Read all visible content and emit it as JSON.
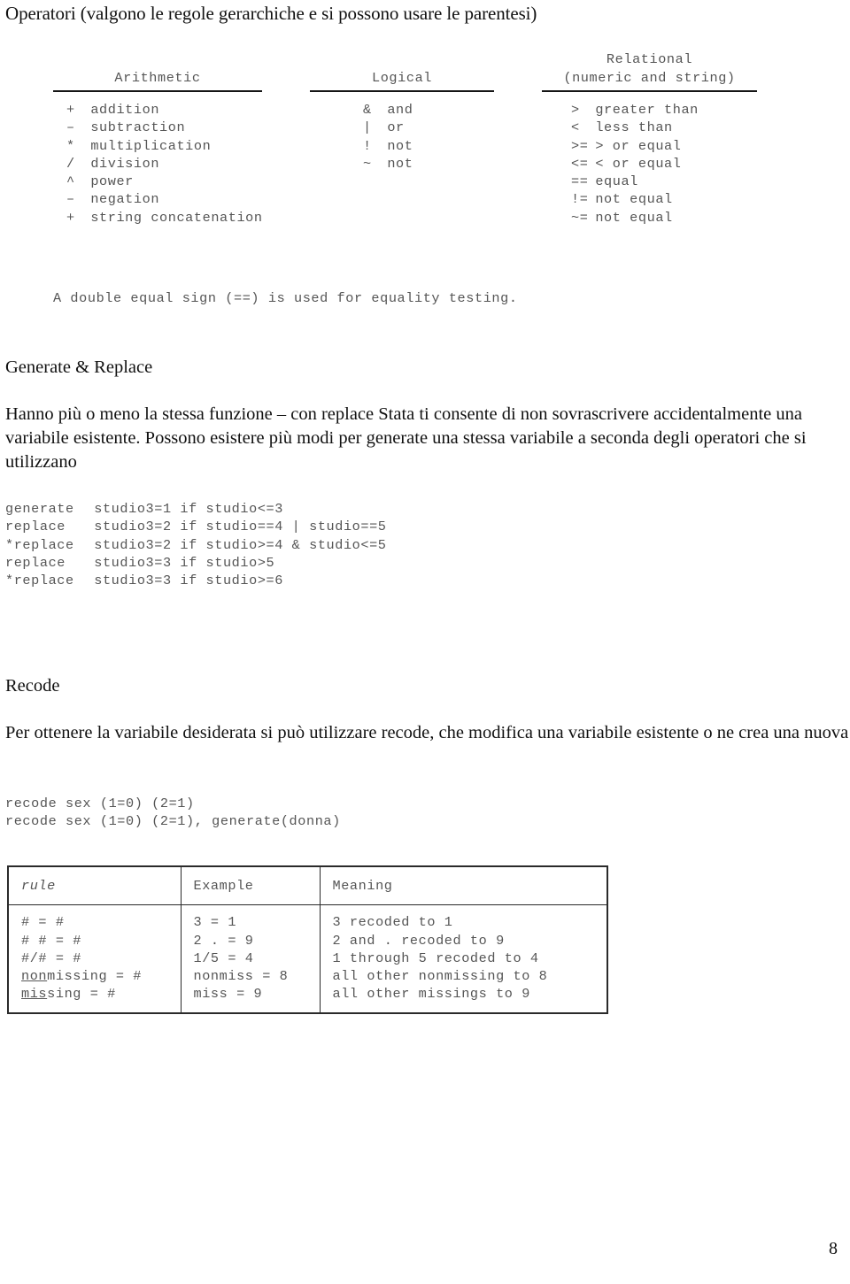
{
  "document": {
    "page_number": "8",
    "title": "Operatori (valgono le regole gerarchiche e si possono usare le parentesi)"
  },
  "operator_table": {
    "columns": [
      {
        "id": "arithmetic",
        "header_line1": "",
        "header_line2": "Arithmetic",
        "rows": [
          {
            "symbol": "+",
            "meaning": "addition"
          },
          {
            "symbol": "–",
            "meaning": "subtraction"
          },
          {
            "symbol": "*",
            "meaning": "multiplication"
          },
          {
            "symbol": "/",
            "meaning": "division"
          },
          {
            "symbol": "^",
            "meaning": "power"
          },
          {
            "symbol": "–",
            "meaning": "negation"
          },
          {
            "symbol": "+",
            "meaning": "string concatenation"
          }
        ]
      },
      {
        "id": "logical",
        "header_line1": "",
        "header_line2": "Logical",
        "rows": [
          {
            "symbol": "&",
            "meaning": "and"
          },
          {
            "symbol": "|",
            "meaning": "or"
          },
          {
            "symbol": "!",
            "meaning": "not"
          },
          {
            "symbol": "~",
            "meaning": "not"
          }
        ]
      },
      {
        "id": "relational",
        "header_line1": "Relational",
        "header_line2": "(numeric and string)",
        "rows": [
          {
            "symbol": ">",
            "meaning": "greater than"
          },
          {
            "symbol": "<",
            "meaning": "less than"
          },
          {
            "symbol": ">=",
            "meaning": "> or equal"
          },
          {
            "symbol": "<=",
            "meaning": "< or equal"
          },
          {
            "symbol": "==",
            "meaning": "equal"
          },
          {
            "symbol": "!=",
            "meaning": "not equal"
          },
          {
            "symbol": "~=",
            "meaning": "not equal"
          }
        ]
      }
    ],
    "note": "A double equal sign (==) is used for equality testing."
  },
  "generate_replace": {
    "heading": "Generate & Replace",
    "paragraph": "Hanno più o meno la stessa funzione – con replace  Stata ti consente di non sovrascrivere accidentalmente una variabile esistente. Possono esistere più modi per generate una stessa variabile a seconda degli operatori che si utilizzano",
    "code_lines": [
      {
        "command": "generate",
        "expression": "studio3=1 if studio<=3"
      },
      {
        "command": "replace",
        "expression": "studio3=2 if studio==4 | studio==5"
      },
      {
        "command": "*replace",
        "expression": "studio3=2 if studio>=4 & studio<=5"
      },
      {
        "command": "replace",
        "expression": "studio3=3 if studio>5"
      },
      {
        "command": "*replace",
        "expression": "studio3=3 if studio>=6"
      }
    ]
  },
  "recode": {
    "heading": "Recode",
    "paragraph": "Per ottenere la variabile desiderata si può utilizzare recode, che modifica una variabile esistente o ne crea una nuova",
    "code_lines": [
      "recode sex (1=0) (2=1)",
      "recode sex (1=0) (2=1), generate(donna)"
    ]
  },
  "rules_table": {
    "headers": [
      "rule",
      "Example",
      "Meaning"
    ],
    "rows": [
      {
        "rule_prefix": "",
        "rule_rest": "# = #",
        "example": "3 = 1",
        "meaning": "3 recoded to 1"
      },
      {
        "rule_prefix": "",
        "rule_rest": "# # = #",
        "example": "2 . = 9",
        "meaning": "2 and . recoded to 9"
      },
      {
        "rule_prefix": "",
        "rule_rest": "#/# = #",
        "example": "1/5 = 4",
        "meaning": "1 through 5 recoded to 4"
      },
      {
        "rule_prefix": "non",
        "rule_rest": "missing = #",
        "example": "nonmiss = 8",
        "meaning": "all other nonmissing to 8"
      },
      {
        "rule_prefix": "mis",
        "rule_rest": "sing = #",
        "example": "miss = 9",
        "meaning": "all other missings to 9"
      }
    ]
  }
}
